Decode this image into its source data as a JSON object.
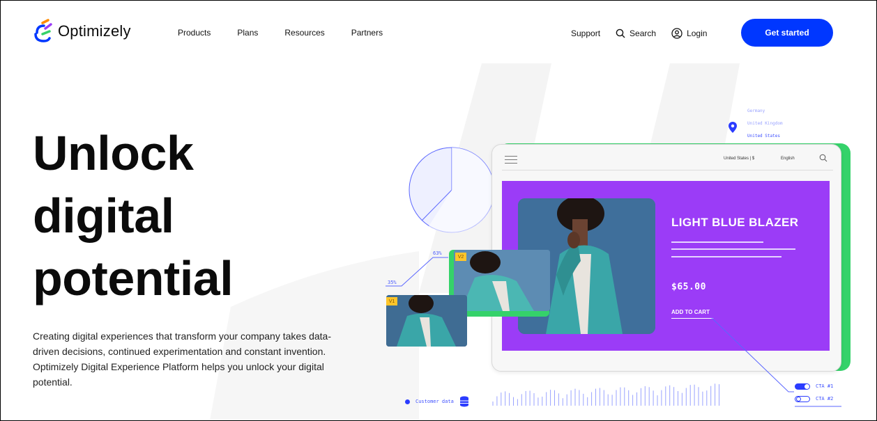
{
  "nav": {
    "logo_text": "Optimizely",
    "links": [
      "Products",
      "Plans",
      "Resources",
      "Partners"
    ],
    "support": "Support",
    "search": "Search",
    "login": "Login",
    "cta": "Get started"
  },
  "hero": {
    "title_lines": [
      "Unlock",
      "digital",
      "potential"
    ],
    "description": "Creating digital experiences that transform your company takes data-driven decisions, continued experimentation and constant invention. Optimizely Digital Experience Platform helps you unlock your digital potential."
  },
  "illustration": {
    "locales": [
      "Germany",
      "United Kingdom",
      "United States"
    ],
    "tablet_locale": "United States | $",
    "tablet_language": "English",
    "product_title": "LIGHT BLUE BLAZER",
    "price": "$65.00",
    "add_to_cart": "ADD TO CART",
    "variant_v1": "V1",
    "variant_v2": "V2",
    "pct_v2": "63%",
    "pct_v1": "35%",
    "customer_data": "Customer data",
    "cta1": "CTA #1",
    "cta2": "CTA #2"
  },
  "colors": {
    "accent": "#0037ff",
    "purple": "#9b3cf7",
    "green": "#35d26a",
    "badge": "#ffc52a"
  },
  "icons": {
    "logo": "optimizely-logo-icon",
    "search": "search-icon",
    "login": "user-circle-icon",
    "location": "map-pin-icon",
    "database": "database-icon"
  }
}
